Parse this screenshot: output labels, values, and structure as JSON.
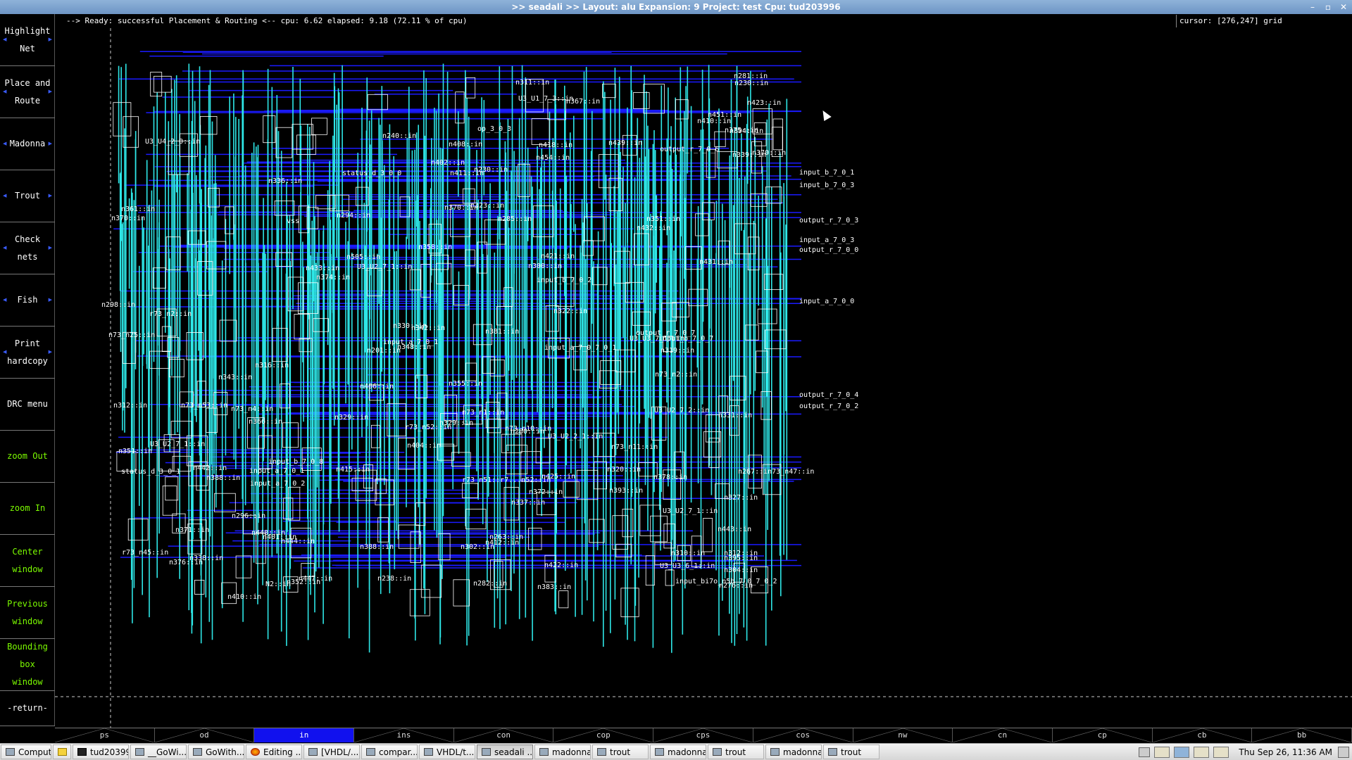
{
  "window": {
    "title": ">> seadali >>   Layout: alu  Expansion: 9  Project: test  Cpu: tud203996",
    "controls": [
      "–",
      "▫",
      "✕"
    ]
  },
  "status": {
    "message": "--> Ready: successful Placement & Routing <-- cpu: 6.62  elapsed: 9.18 (72.11 % of cpu)",
    "cursor": "cursor: [276,247] grid"
  },
  "menu": [
    {
      "label": "Highlight\nNet",
      "color": "white",
      "marks": true
    },
    {
      "label": "Place and\nRoute",
      "color": "white",
      "marks": true
    },
    {
      "label": "Madonna",
      "color": "white",
      "marks": true
    },
    {
      "label": "Trout",
      "color": "white",
      "marks": true
    },
    {
      "label": "Check\nnets",
      "color": "white",
      "marks": true
    },
    {
      "label": "Fish",
      "color": "white",
      "marks": true
    },
    {
      "label": "Print\nhardcopy",
      "color": "white",
      "marks": true
    },
    {
      "label": "DRC menu",
      "color": "white",
      "marks": false
    },
    {
      "label": "zoom Out",
      "color": "green",
      "marks": false
    },
    {
      "label": "zoom In",
      "color": "green",
      "marks": false
    },
    {
      "label": "Center\nwindow",
      "color": "green",
      "marks": false
    },
    {
      "label": "Previous\nwindow",
      "color": "green",
      "marks": false
    },
    {
      "label": "Bounding box\nwindow",
      "color": "green",
      "marks": false
    },
    {
      "label": "-return-",
      "color": "white",
      "marks": false
    }
  ],
  "labels": [
    "r73_n51::r7...n52::in",
    "n267::in73_n47::in",
    "r73_n45::in",
    "output_r_7_0_7",
    "status_d_3_0_0",
    "input_a_7_0_2",
    "U3_U3_6_1::in",
    "input_b_7_0_7",
    "U3_U2_7_1::in",
    "n276::in",
    "output_r_7_0_6",
    "op_3_0_3",
    "n358::in",
    "n412::in",
    "input_b_7_0_8",
    "n395::in",
    "n73_n53::in",
    "n316::in",
    "U3_U4_2_0::in",
    "U3_U2_2_1::in",
    "n294::in",
    "input_a_7_0_1",
    "r73_n52::in",
    "vss",
    "input_bi7o_n5b_7_0_7_0_2",
    "input_b_7_0_2",
    "U3_U2_7_1::in",
    "n311::in",
    "n312::in",
    "n329::in",
    "n348::in",
    "n201::in",
    "n448::in",
    "n296::in",
    "n351::in",
    "n331::in",
    "n73_n2::in",
    "n322::in",
    "n73_n11::in",
    "n73_n25::in",
    "n410::in",
    "n330::in",
    "n432::in",
    "n425::in",
    "n421::in",
    "n451::in",
    "n393::in",
    "n423::in",
    "n447::in",
    "n367::in",
    "n454::in",
    "n415::in",
    "n230::in",
    "n505::in",
    "n406::in",
    "n388::in",
    "n433::in",
    "n404::in",
    "n342::in",
    "n343::in",
    "n370::in",
    "n444::in",
    "n411::in",
    "n394::in",
    "n431::in",
    "status_d_3_0_1",
    "n285::in",
    "n338::in",
    "n351::in",
    "n376::in",
    "n310::in",
    "n281::in",
    "n366::in",
    "n263::in",
    "n312::in",
    "n327::in",
    "n443::in",
    "n361::in",
    "n408::in",
    "n418::in",
    "n238::in",
    "n320::in",
    "n304::in",
    "n300::in",
    "n319::in",
    "n370::in",
    "n298::in",
    "n230::in",
    "n371::in",
    "n372::in",
    "n339::in",
    "n375::in",
    "n302::in",
    "n336::in",
    "n402::in",
    "n410::in",
    "n378::in",
    "n337::in",
    "n352::in",
    "n355::in",
    "N2::in",
    "n282::in",
    "input_a_7_0_1",
    "input_a_7_0_7_0_1",
    "r73_n2::in",
    "n329::in",
    "n401::in",
    "n370::in",
    "U3_U2_7_1::in",
    "n374::in",
    "U3_U2_7_2::in",
    "U3_U3_7_1::in",
    "U3_U1_7_3::in",
    "n439::in",
    "n240::in",
    "n383::in",
    "n73_n1::in",
    "n73_n4::in",
    "n73_n10::in",
    "n422::in",
    "n381::in",
    "n280::in",
    "n323::in",
    "n442::in",
    "n388::in"
  ],
  "io_labels": [
    "input_b_7_0_1",
    "input_b_7_0_3",
    "output_r_7_0_3",
    "input_a_7_0_3",
    "output_r_7_0_0",
    "input_a_7_0_0",
    "output_r_7_0_4",
    "output_r_7_0_2"
  ],
  "tabs": [
    {
      "label": "ps",
      "active": false
    },
    {
      "label": "od",
      "active": false
    },
    {
      "label": "in",
      "active": true
    },
    {
      "label": "ins",
      "active": false
    },
    {
      "label": "con",
      "active": false
    },
    {
      "label": "cop",
      "active": false
    },
    {
      "label": "cps",
      "active": false
    },
    {
      "label": "cos",
      "active": false
    },
    {
      "label": "nw",
      "active": false
    },
    {
      "label": "cn",
      "active": false
    },
    {
      "label": "cp",
      "active": false
    },
    {
      "label": "cb",
      "active": false
    },
    {
      "label": "bb",
      "active": false
    }
  ],
  "taskbar": {
    "items": [
      {
        "label": "Computer",
        "icon": "computer"
      },
      {
        "label": "",
        "icon": "note"
      },
      {
        "label": "tud203996",
        "icon": "term"
      },
      {
        "label": "__GoWi...",
        "icon": "window"
      },
      {
        "label": "GoWith...",
        "icon": "window"
      },
      {
        "label": "Editing ...",
        "icon": "fire"
      },
      {
        "label": "[VHDL/...",
        "icon": "window"
      },
      {
        "label": "compar...",
        "icon": "window"
      },
      {
        "label": "VHDL/t...",
        "icon": "window"
      },
      {
        "label": "seadali ...",
        "icon": "window",
        "active": true
      },
      {
        "label": "madonna",
        "icon": "window"
      },
      {
        "label": "trout",
        "icon": "window"
      },
      {
        "label": "madonna",
        "icon": "window"
      },
      {
        "label": "trout",
        "icon": "window"
      },
      {
        "label": "madonna",
        "icon": "window"
      },
      {
        "label": "trout",
        "icon": "window"
      }
    ],
    "clock": "Thu Sep 26, 11:36 AM"
  },
  "colors": {
    "wire_vertical": "#2ee6e6",
    "wire_horizontal": "#1a1aff",
    "cell_outline": "#ffffff",
    "background": "#000000",
    "active_tab": "#1111ee",
    "menu_green": "#7cfc00"
  }
}
